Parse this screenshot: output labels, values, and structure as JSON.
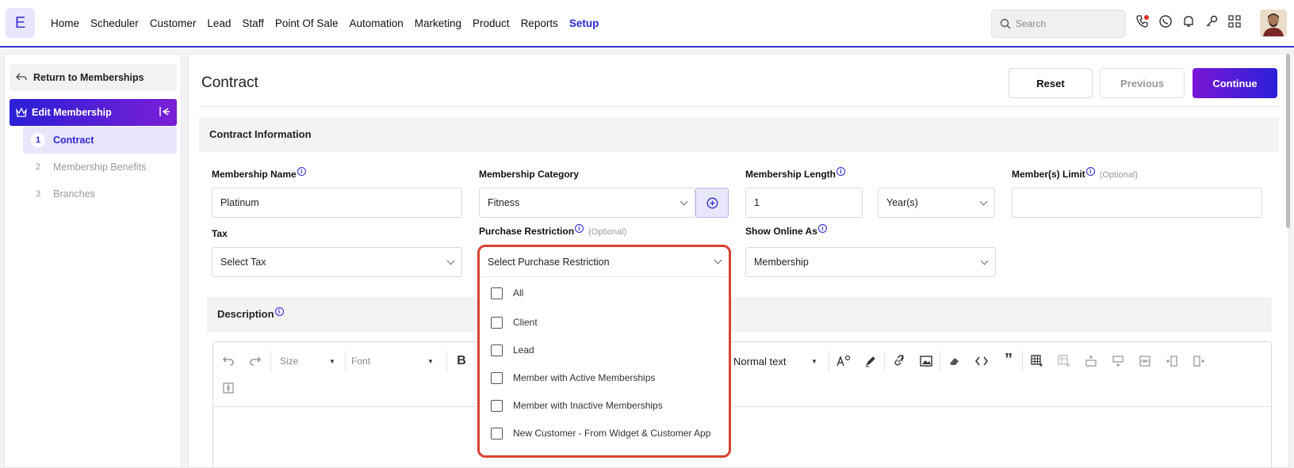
{
  "logo": "E",
  "nav": [
    "Home",
    "Scheduler",
    "Customer",
    "Lead",
    "Staff",
    "Point Of Sale",
    "Automation",
    "Marketing",
    "Product",
    "Reports",
    "Setup"
  ],
  "nav_active": "Setup",
  "search": {
    "placeholder": "Search"
  },
  "sidebar": {
    "return_label": "Return to Memberships",
    "edit_label": "Edit Membership",
    "steps": [
      {
        "num": "1",
        "label": "Contract"
      },
      {
        "num": "2",
        "label": "Membership Benefits"
      },
      {
        "num": "3",
        "label": "Branches"
      }
    ]
  },
  "main": {
    "title": "Contract",
    "reset": "Reset",
    "previous": "Previous",
    "continue": "Continue",
    "section": "Contract Information",
    "fields": {
      "name_label": "Membership Name",
      "name_value": "Platinum",
      "category_label": "Membership Category",
      "category_value": "Fitness",
      "length_label": "Membership Length",
      "length_value": "1",
      "length_unit": "Year(s)",
      "limit_label": "Member(s) Limit",
      "optional": "(Optional)",
      "tax_label": "Tax",
      "tax_value": "Select Tax",
      "restriction_label": "Purchase Restriction",
      "restriction_value": "Select Purchase Restriction",
      "online_label": "Show Online As",
      "online_value": "Membership"
    },
    "description": "Description",
    "toolbar": {
      "size": "Size",
      "font": "Font",
      "bold": "B",
      "paragraph": "Normal text"
    }
  },
  "dropdown_options": [
    "All",
    "Client",
    "Lead",
    "Member with Active Memberships",
    "Member with Inactive Memberships",
    "New Customer - From Widget & Customer App"
  ],
  "colors": {
    "accent": "#2f25d8",
    "highlight": "#d8432f"
  }
}
